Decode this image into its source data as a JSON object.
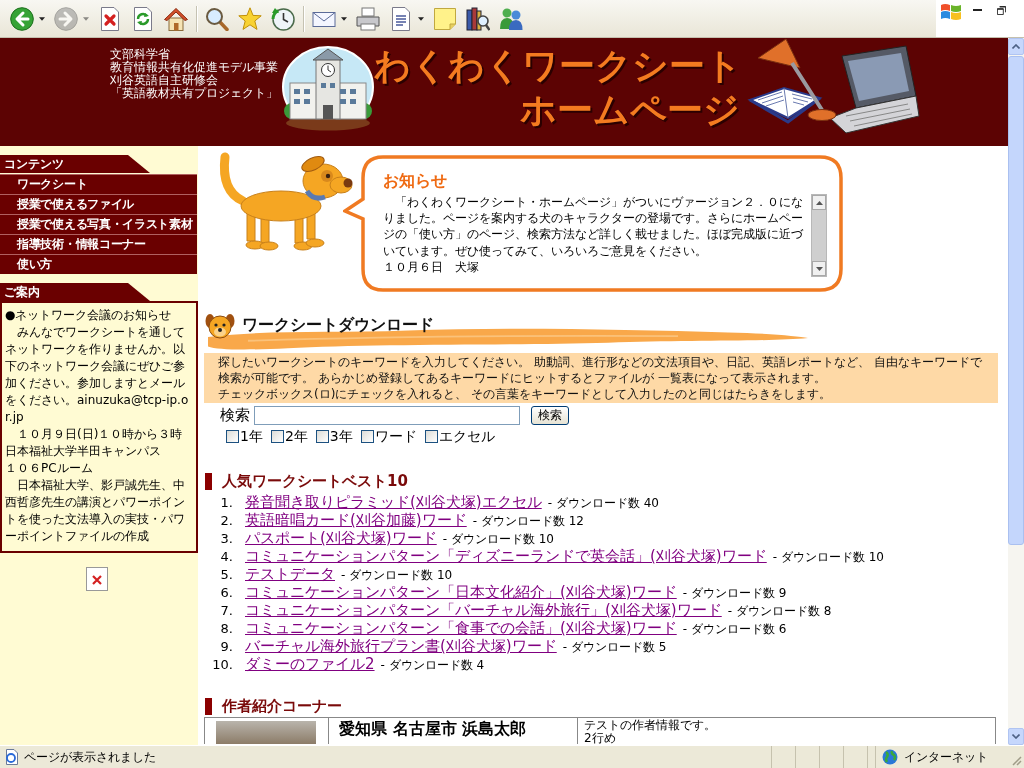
{
  "toolbar": {
    "groups": [
      [
        {
          "kind": "back",
          "menu": true,
          "disabled": false
        },
        {
          "kind": "forward",
          "menu": true,
          "disabled": true
        },
        {
          "kind": "stop",
          "menu": false,
          "disabled": false
        },
        {
          "kind": "refresh",
          "menu": false,
          "disabled": false
        },
        {
          "kind": "home",
          "menu": false,
          "disabled": false
        }
      ],
      [
        {
          "kind": "search",
          "menu": false,
          "disabled": false
        },
        {
          "kind": "favorites",
          "menu": false,
          "disabled": false
        },
        {
          "kind": "history",
          "menu": false,
          "disabled": false
        }
      ],
      [
        {
          "kind": "mail",
          "menu": true,
          "disabled": false
        },
        {
          "kind": "print",
          "menu": false,
          "disabled": false
        },
        {
          "kind": "edit",
          "menu": true,
          "disabled": false
        },
        {
          "kind": "note",
          "menu": false,
          "disabled": false
        },
        {
          "kind": "research",
          "menu": false,
          "disabled": false
        },
        {
          "kind": "messenger",
          "menu": false,
          "disabled": false
        }
      ]
    ]
  },
  "banner": {
    "organization": [
      "文部科学省",
      "教育情報共有化促進モデル事業",
      "刈谷英語自主研修会",
      "「英語教材共有プロジェクト」"
    ],
    "title": [
      "わくわくワークシート",
      "ホームページ"
    ]
  },
  "sidebar": {
    "contents": {
      "heading": "コンテンツ",
      "items": [
        "ワークシート",
        "授業で使えるファイル",
        "授業で使える写真・イラスト素材",
        "指導技術・情報コーナー",
        "使い方"
      ]
    },
    "info": {
      "heading": "ご案内",
      "paragraphs": [
        "●ネットワーク会議のお知らせ",
        "　みんなでワークシートを通してネットワークを作りませんか。以下のネットワーク会議にぜひご参加ください。参加しますとメールをください。ainuzuka@tcp-ip.or.jp",
        "　１０月９日(日)１０時から３時",
        "日本福祉大学半田キャンパス",
        "１０６PCルーム",
        "　日本福祉大学、影戸誠先生、中西哲彦先生の講演とパワーポイントを使った文法導入の実技・パワーポイントファイルの作成"
      ]
    }
  },
  "notice": {
    "title": "お知らせ",
    "text": "　「わくわくワークシート・ホームページ」がついにヴァージョン２．０になりました。ページを案内する犬のキャラクターの登場です。さらにホームページの「使い方」のページ、検索方法など詳しく載せました。ほぼ完成版に近づいています。ぜひ使ってみて、いろいろご意見をください。",
    "signature": "１０月６日　犬塚"
  },
  "download": {
    "heading": "ワークシートダウンロード",
    "description": [
      "探したいワークシートのキーワードを入力してください。 助動詞、進行形などの文法項目や、日記、英語レポートなど、 自由なキーワードで検索が可能です。 あらかじめ登録してあるキーワードにヒットするとファイルが 一覧表になって表示されます。",
      "チェックボックス(ロ)にチェックを入れると、 その言葉をキーワードとして入力したのと同じはたらきをします。"
    ],
    "search": {
      "label": "検索",
      "button": "検索"
    },
    "filters": [
      {
        "label": "1年",
        "checked": false
      },
      {
        "label": "2年",
        "checked": false
      },
      {
        "label": "3年",
        "checked": false
      },
      {
        "label": "ワード",
        "checked": false
      },
      {
        "label": "エクセル",
        "checked": false
      }
    ]
  },
  "ranking": {
    "heading": "人気ワークシートベスト10",
    "items": [
      {
        "number": "1.",
        "title": "発音聞き取りピラミッド(刈谷犬塚)エクセル",
        "downloads": "- ダウンロード数 40"
      },
      {
        "number": "2.",
        "title": "英語暗唱カード(刈谷加藤)ワード",
        "downloads": "- ダウンロード数 12"
      },
      {
        "number": "3.",
        "title": "パスポート(刈谷犬塚)ワード",
        "downloads": "- ダウンロード数 10"
      },
      {
        "number": "4.",
        "title": "コミュニケーションパターン「ディズニーランドで英会話」(刈谷犬塚)ワード",
        "downloads": "- ダウンロード数 10"
      },
      {
        "number": "5.",
        "title": "テストデータ",
        "downloads": "- ダウンロード数 10"
      },
      {
        "number": "6.",
        "title": "コミュニケーションパターン「日本文化紹介」(刈谷犬塚)ワード",
        "downloads": "- ダウンロード数 9"
      },
      {
        "number": "7.",
        "title": "コミュニケーションパターン「バーチャル海外旅行」(刈谷犬塚)ワード",
        "downloads": "- ダウンロード数 8"
      },
      {
        "number": "8.",
        "title": "コミュニケーションパターン「食事での会話」(刈谷犬塚)ワード",
        "downloads": "- ダウンロード数 6"
      },
      {
        "number": "9.",
        "title": "バーチャル海外旅行プラン書(刈谷犬塚)ワード",
        "downloads": "- ダウンロード数 5"
      },
      {
        "number": "10.",
        "title": "ダミーのファイル2",
        "downloads": "- ダウンロード数 4"
      }
    ]
  },
  "authors": {
    "heading": "作者紹介コーナー",
    "rows": [
      {
        "name": "愛知県 名古屋市 浜島太郎",
        "info": [
          "テストの作者情報です。",
          "2行め"
        ]
      }
    ]
  },
  "status_bar": {
    "text": "ページが表示されました",
    "zone": "インターネット"
  }
}
